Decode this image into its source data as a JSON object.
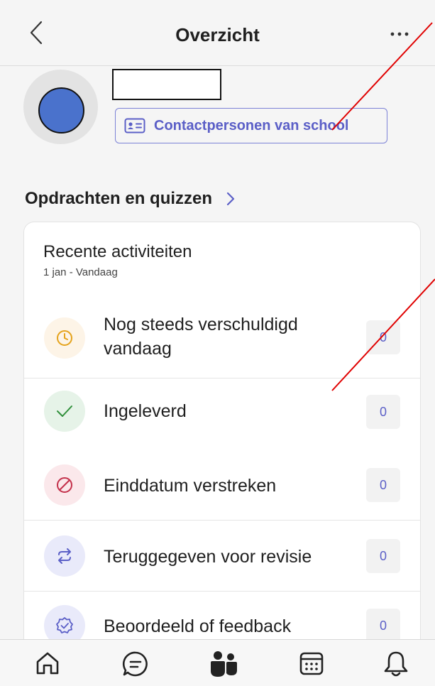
{
  "header": {
    "title": "Overzicht",
    "back_icon": "chevron-left-icon",
    "more_icon": "more-horizontal-icon"
  },
  "profile": {
    "contact_button_label": "Contactpersonen van school",
    "contact_icon": "contact-card-icon"
  },
  "assignments": {
    "section_title": "Opdrachten en quizzen",
    "card_title": "Recente activiteiten",
    "date_range": "1 jan - Vandaag",
    "rows": [
      {
        "label_line1": "Nog steeds verschuldigd",
        "label_line2": "vandaag",
        "count": "0",
        "icon": "clock-icon",
        "icon_color": "#e5a31c",
        "icon_bg": "#fdf4e7"
      },
      {
        "label": "Ingeleverd",
        "count": "0",
        "icon": "checkmark-icon",
        "icon_color": "#2f8f3a",
        "icon_bg": "#e6f3e8"
      },
      {
        "label": "Einddatum verstreken",
        "count": "0",
        "icon": "prohibited-icon",
        "icon_color": "#c4314b",
        "icon_bg": "#fbe8eb"
      },
      {
        "label": "Teruggegeven voor revisie",
        "count": "0",
        "icon": "arrow-repeat-icon",
        "icon_color": "#5b5fc7",
        "icon_bg": "#e9eafa"
      },
      {
        "label": "Beoordeeld of feedback",
        "count": "0",
        "icon": "badge-check-icon",
        "icon_color": "#5b5fc7",
        "icon_bg": "#e9eafa"
      }
    ]
  },
  "tabbar": {
    "tabs": [
      "home-icon",
      "chat-icon",
      "teams-icon",
      "calendar-icon",
      "bell-icon"
    ]
  },
  "colors": {
    "accent": "#5b5fc7",
    "annotation": "#e00000"
  }
}
